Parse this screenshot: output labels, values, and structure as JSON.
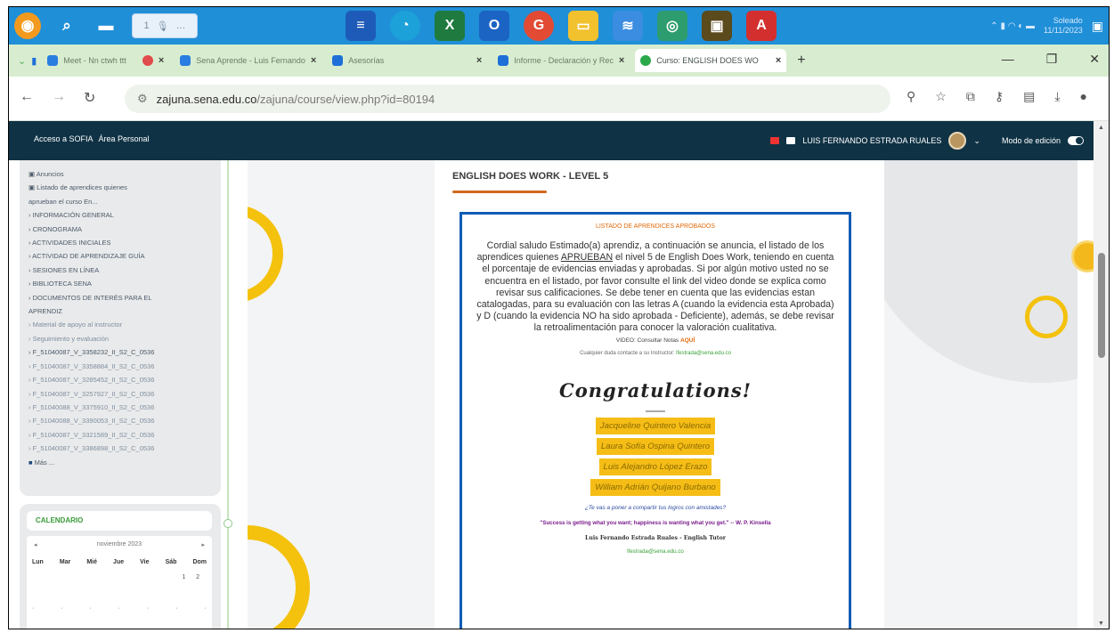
{
  "taskbar": {
    "search_text": "1",
    "apps": [
      "Word",
      "Edge",
      "Excel",
      "Outlook",
      "Chrome",
      "File Explorer",
      "Terminal",
      "Photos",
      "Files",
      "Acrobat"
    ],
    "tray": {
      "line1": "Soleado",
      "line2": "11/11/2023"
    }
  },
  "tabs": [
    {
      "label": "Meet - Nn ctwh ttt",
      "color": "#2a7de1"
    },
    {
      "label": "",
      "color": "#e04b4b"
    },
    {
      "label": "Sena Aprende - Luis Fernando",
      "color": "#2a7de1"
    },
    {
      "label": "Asesorías",
      "color": "#1e6fd8"
    },
    {
      "label": "Informe - Declaración y Rec",
      "color": "#1e6fd8"
    },
    {
      "label": "Curso: ENGLISH DOES WO",
      "color": "#2aa84a"
    }
  ],
  "addressbar": {
    "url_host": "zajuna.sena.edu.co",
    "url_path": "/zajuna/course/view.php?id=80194"
  },
  "moodle_nav": {
    "left_items": [
      "Acceso a SOFIA",
      "Área Personal"
    ],
    "user_name": "LUIS FERNANDO ESTRADA RUALES",
    "edit_mode": "Modo de edición"
  },
  "sidebar": {
    "items": [
      "Anuncios",
      "Listado de aprendices quienes",
      "aprueban el curso En...",
      "INFORMACIÓN GENERAL",
      "CRONOGRAMA",
      "ACTIVIDADES INICIALES",
      "ACTIVIDAD DE APRENDIZAJE GUÍA",
      "SESIONES EN LÍNEA",
      "BIBLIOTECA SENA",
      "DOCUMENTOS DE INTERÉS PARA EL",
      "APRENDIZ",
      "Material de apoyo al instructor",
      "Seguimiento y evaluación",
      "F_51040087_V_3358232_II_S2_C_0536",
      "F_51040087_V_3358884_II_S2_C_0536",
      "F_51040087_V_3285452_II_S2_C_0536",
      "F_51040087_V_3257927_II_S2_C_0536",
      "F_51040088_V_3375910_II_S2_C_0536",
      "F_51040088_V_3390053_II_S2_C_0536",
      "F_51040087_V_3321589_II_S2_C_0536",
      "F_51040087_V_3386898_II_S2_C_0536",
      "Más ..."
    ],
    "calendar_title": "CALENDARIO",
    "calendar_month": "noviembre 2023",
    "calendar_days": [
      "Lun",
      "Mar",
      "Mié",
      "Jue",
      "Vie",
      "Sáb",
      "Dom"
    ]
  },
  "course": {
    "title": "ENGLISH DOES WORK - LEVEL 5",
    "card_heading": "LISTADO DE APRENDICES APROBADOS",
    "body_part1": "Cordial saludo Estimado(a) aprendiz, a continuación se anuncia, el listado de los aprendices quienes ",
    "body_underline": "APRUEBAN",
    "body_part2": " el nivel 5 de English Does Work, teniendo en cuenta el porcentaje de evidencias enviadas y aprobadas. Si por algún motivo usted no se encuentra en el listado, por favor consulte el link del video donde se explica como revisar sus calificaciones. Se debe tener en cuenta que las evidencias estan catalogadas, para su evaluación con las letras A (cuando la evidencia esta Aprobada) y D (cuando la evidencia NO ha sido aprobada - Deficiente), además, se debe revisar la retroalimentación para conocer la valoración cualitativa.",
    "video_text": "VIDEO: Consultar Notas",
    "video_link": "AQUÍ",
    "contact_text": "Cualquier duda contacte a su Instructor:",
    "contact_email": "lfestrada@sena.edu.co",
    "congrats": "Congratulations!",
    "approved": [
      "Jacqueline Quintero Valencia",
      "Laura Sofía Ospina Quintero",
      "Luis Alejandro López Erazo",
      "William Adrián Quijano Burbano"
    ],
    "quote1": "¿Te vas a poner a compartir tus logros con amistades?",
    "quote2": "\"Success is getting what you want; happiness is wanting what you get.\" -- W. P. Kinsella",
    "signature": "Luis Fernando Estrada Ruales - English Tutor",
    "signature_email": "lfestrada@sena.edu.co"
  },
  "colors": {
    "taskbar": "#1f8fd8",
    "moodle_nav": "#0f3245",
    "accent_yellow": "#f4c10d",
    "card_border": "#0f5db5"
  }
}
